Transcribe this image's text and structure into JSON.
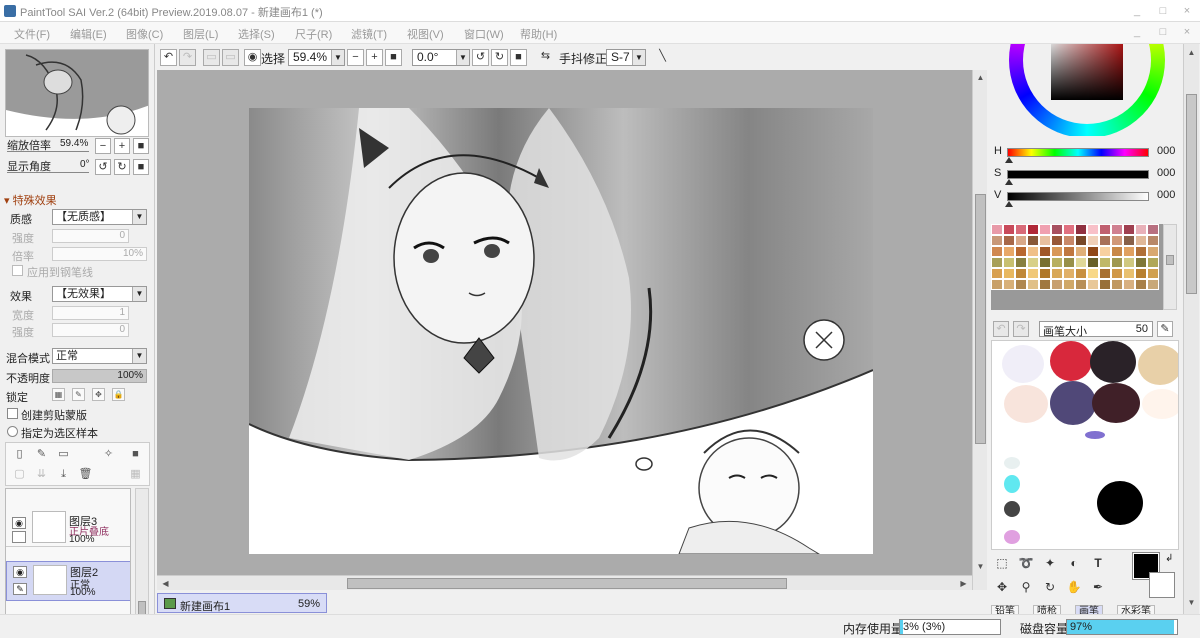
{
  "window": {
    "title": "PaintTool SAI Ver.2 (64bit) Preview.2019.08.07 - 新建画布1 (*)",
    "controls": [
      "_",
      "□",
      "×"
    ]
  },
  "menu": {
    "items": [
      "文件(F)",
      "编辑(E)",
      "图像(C)",
      "图层(L)",
      "选择(S)",
      "尺子(R)",
      "滤镜(T)",
      "视图(V)",
      "窗口(W)",
      "帮助(H)"
    ]
  },
  "navigator": {
    "zoom_label": "缩放倍率",
    "zoom_value": "59.4%",
    "angle_label": "显示角度",
    "angle_value": "0°"
  },
  "effects": {
    "section_title": "特殊效果",
    "texture_label": "质感",
    "texture_value": "【无质感】",
    "strength_label": "强度",
    "strength_value": "0",
    "rate_label": "倍率",
    "rate_value": "10%",
    "apply_pen_label": "应用到钢笔线",
    "effect_label": "效果",
    "effect_value": "【无效果】",
    "width_label": "宽度",
    "width_value": "1",
    "effect_strength_label": "强度",
    "effect_strength_value": "0"
  },
  "layer_props": {
    "blend_label": "混合模式",
    "blend_value": "正常",
    "opacity_label": "不透明度",
    "opacity_value": "100%",
    "lock_label": "锁定",
    "clip_label": "创建剪贴蒙版",
    "select_source_label": "指定为选区样本"
  },
  "layers": [
    {
      "name": "图层3",
      "mode": "正片叠底",
      "opacity": "100%"
    },
    {
      "name": "图层2",
      "mode": "正常",
      "opacity": "100%"
    }
  ],
  "toolbar": {
    "select_label": "选择",
    "zoom_value": "59.4%",
    "angle_value": "0.0°",
    "stabilizer_label": "手抖修正",
    "stabilizer_value": "S-7"
  },
  "canvas_tab": {
    "name": "新建画布1",
    "zoom": "59%"
  },
  "color": {
    "h_label": "H",
    "h_value": "000",
    "s_label": "S",
    "s_value": "000",
    "v_label": "V",
    "v_value": "000",
    "foreground": "#000000",
    "background": "#ffffff"
  },
  "swatches": [
    "#e89aa8",
    "#c84a5a",
    "#d86a78",
    "#b02838",
    "#f0a0b0",
    "#a85060",
    "#e07080",
    "#903040",
    "#f8c0c8",
    "#c06070",
    "#d08090",
    "#a04050",
    "#e8b0b8",
    "#b87080",
    "#c89878",
    "#a86848",
    "#d8a888",
    "#885838",
    "#e8c0a0",
    "#985838",
    "#c88868",
    "#784828",
    "#f0d0b8",
    "#a87058",
    "#d09878",
    "#886048",
    "#e0b898",
    "#b88868",
    "#d08850",
    "#e8a868",
    "#b86830",
    "#f0c088",
    "#a05828",
    "#d89858",
    "#c07840",
    "#e0b078",
    "#904818",
    "#f8d0a0",
    "#c88848",
    "#e0a060",
    "#b07038",
    "#d8a870",
    "#a8a058",
    "#c8c070",
    "#888040",
    "#d8d088",
    "#787030",
    "#b8b060",
    "#989048",
    "#e0d898",
    "#686028",
    "#c0b868",
    "#a09850",
    "#d0c880",
    "#807838",
    "#b0a858",
    "#d8a050",
    "#e8b860",
    "#c08838",
    "#f0c878",
    "#b07828",
    "#d8a858",
    "#e0b068",
    "#c89040",
    "#f8d888",
    "#a87030",
    "#d09848",
    "#e8c070",
    "#b88030",
    "#d0a050",
    "#c8a068",
    "#d8b078",
    "#b08850",
    "#e0c088",
    "#a07840",
    "#c8a070",
    "#d0a868",
    "#b89058",
    "#e8c898",
    "#987038",
    "#c09860",
    "#d8b080",
    "#a88048",
    "#c8a878"
  ],
  "brush": {
    "size_label": "画笔大小",
    "size_value": "50",
    "tabs": [
      "铅笔",
      "喷枪",
      "画笔",
      "水彩笔"
    ]
  },
  "status": {
    "memory_label": "内存使用量",
    "memory_value": "3% (3%)",
    "memory_fraction": 0.03,
    "disk_label": "磁盘容量",
    "disk_value": "97%",
    "disk_fraction": 0.97
  }
}
